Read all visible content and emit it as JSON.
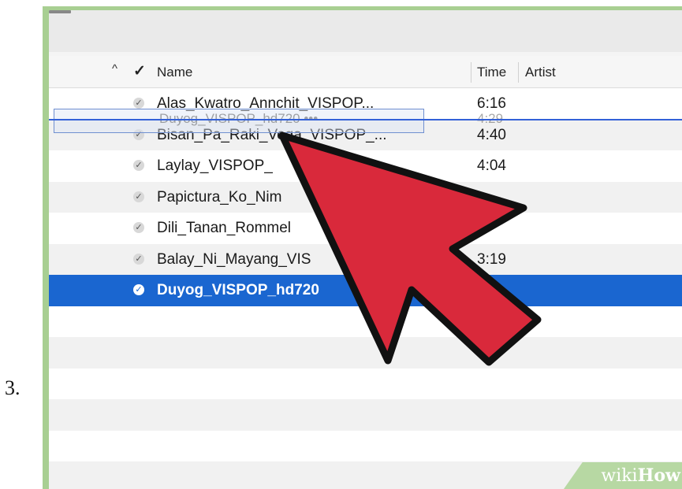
{
  "step": {
    "number": "3."
  },
  "header": {
    "sort_icon": "chevron-up-icon",
    "check_symbol": "✓",
    "columns": {
      "name": "Name",
      "time": "Time",
      "artist": "Artist"
    }
  },
  "tracks": [
    {
      "name": "Alas_Kwatro_Annchit_VISPOP...",
      "time": "6:16",
      "checked": true
    },
    {
      "name": "Bisan_Pa_Raki_Vega_VISPOP_...",
      "time": "4:40",
      "checked": true
    },
    {
      "name": "Laylay_VISPOP_",
      "time": "4:04",
      "checked": true
    },
    {
      "name": "Papictura_Ko_Nim",
      "time": "",
      "checked": true
    },
    {
      "name": "Dili_Tanan_Rommel",
      "time": "",
      "checked": true
    },
    {
      "name": "Balay_Ni_Mayang_VIS",
      "time": "3:19",
      "checked": true
    },
    {
      "name": "Duyog_VISPOP_hd720",
      "time": "",
      "checked": true,
      "selected": true
    }
  ],
  "drag_ghost": {
    "name": "Duyog_VISPOP_hd720 •••",
    "time": "4:29"
  },
  "colors": {
    "frame": "#a8cf92",
    "selection": "#1a66d0",
    "drop_line": "#3361d8",
    "cursor": "#d9293b"
  },
  "watermark": {
    "text_light": "wiki",
    "text_bold": "How"
  }
}
